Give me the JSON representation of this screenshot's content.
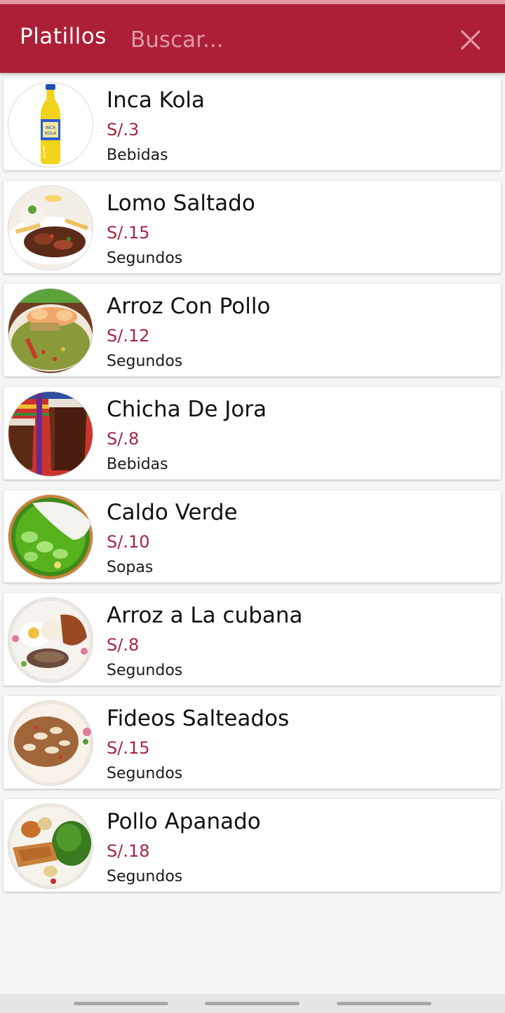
{
  "app": {
    "title": "Platillos",
    "search_placeholder": "Buscar...",
    "accent_color": "#ad1f37",
    "price_color": "#a52640"
  },
  "items": [
    {
      "name": "Inca Kola",
      "price": "S/.3",
      "category": "Bebidas",
      "image": "inca-kola-bottle"
    },
    {
      "name": "Lomo Saltado",
      "price": "S/.15",
      "category": "Segundos",
      "image": "lomo-saltado-plate"
    },
    {
      "name": "Arroz Con Pollo",
      "price": "S/.12",
      "category": "Segundos",
      "image": "arroz-con-pollo-plate"
    },
    {
      "name": "Chicha De Jora",
      "price": "S/.8",
      "category": "Bebidas",
      "image": "chicha-glasses"
    },
    {
      "name": "Caldo Verde",
      "price": "S/.10",
      "category": "Sopas",
      "image": "caldo-verde-bowl"
    },
    {
      "name": "Arroz a La cubana",
      "price": "S/.8",
      "category": "Segundos",
      "image": "arroz-cubana-plate"
    },
    {
      "name": "Fideos Salteados",
      "price": "S/.15",
      "category": "Segundos",
      "image": "fideos-salteados-plate"
    },
    {
      "name": "Pollo Apanado",
      "price": "S/.18",
      "category": "Segundos",
      "image": "pollo-apanado-plate"
    }
  ],
  "navigation": {
    "buttons": [
      "recent-apps",
      "home",
      "back"
    ]
  }
}
